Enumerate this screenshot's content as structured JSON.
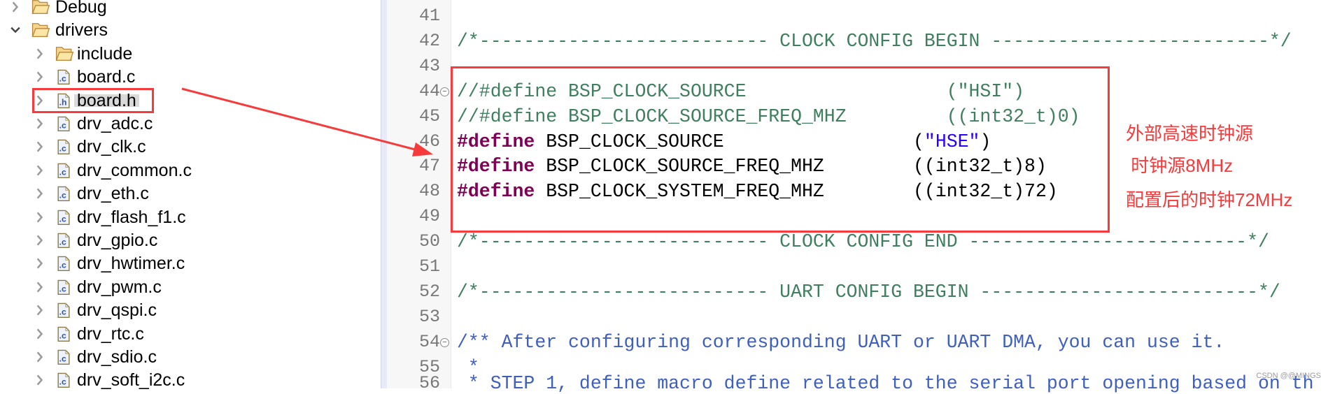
{
  "tree": {
    "items": [
      {
        "label": "Debug",
        "type": "folder",
        "depth": 1,
        "expanded": false
      },
      {
        "label": "drivers",
        "type": "folder",
        "depth": 1,
        "expanded": true
      },
      {
        "label": "include",
        "type": "folder",
        "depth": 2,
        "expanded": false
      },
      {
        "label": "board.c",
        "type": "c-file",
        "depth": 2
      },
      {
        "label": "board.h",
        "type": "h-file",
        "depth": 2,
        "selected": true
      },
      {
        "label": "drv_adc.c",
        "type": "c-file",
        "depth": 2
      },
      {
        "label": "drv_clk.c",
        "type": "c-file",
        "depth": 2
      },
      {
        "label": "drv_common.c",
        "type": "c-file",
        "depth": 2
      },
      {
        "label": "drv_eth.c",
        "type": "c-file",
        "depth": 2
      },
      {
        "label": "drv_flash_f1.c",
        "type": "c-file",
        "depth": 2
      },
      {
        "label": "drv_gpio.c",
        "type": "c-file",
        "depth": 2
      },
      {
        "label": "drv_hwtimer.c",
        "type": "c-file",
        "depth": 2
      },
      {
        "label": "drv_pwm.c",
        "type": "c-file",
        "depth": 2
      },
      {
        "label": "drv_qspi.c",
        "type": "c-file",
        "depth": 2
      },
      {
        "label": "drv_rtc.c",
        "type": "c-file",
        "depth": 2
      },
      {
        "label": "drv_sdio.c",
        "type": "c-file",
        "depth": 2
      },
      {
        "label": "drv_soft_i2c.c",
        "type": "c-file",
        "depth": 2
      }
    ]
  },
  "editor": {
    "lines": [
      {
        "n": "41",
        "parts": []
      },
      {
        "n": "42",
        "parts": [
          {
            "c": "cm",
            "t": "/*-------------------------- CLOCK CONFIG BEGIN -------------------------*/"
          }
        ]
      },
      {
        "n": "43",
        "parts": []
      },
      {
        "n": "44",
        "fold": true,
        "parts": [
          {
            "c": "cm",
            "t": "//#define BSP_CLOCK_SOURCE                  (\"HSI\")"
          }
        ]
      },
      {
        "n": "45",
        "parts": [
          {
            "c": "cm",
            "t": "//#define BSP_CLOCK_SOURCE_FREQ_MHZ         ((int32_t)0)"
          }
        ]
      },
      {
        "n": "46",
        "parts": [
          {
            "c": "kw",
            "t": "#define"
          },
          {
            "c": "",
            "t": " BSP_CLOCK_SOURCE                 ("
          },
          {
            "c": "st",
            "t": "\"HSE\""
          },
          {
            "c": "",
            "t": ")"
          }
        ]
      },
      {
        "n": "47",
        "parts": [
          {
            "c": "kw",
            "t": "#define"
          },
          {
            "c": "",
            "t": " BSP_CLOCK_SOURCE_FREQ_MHZ        ((int32_t)8)"
          }
        ]
      },
      {
        "n": "48",
        "parts": [
          {
            "c": "kw",
            "t": "#define"
          },
          {
            "c": "",
            "t": " BSP_CLOCK_SYSTEM_FREQ_MHZ        ((int32_t)72)"
          }
        ]
      },
      {
        "n": "49",
        "parts": []
      },
      {
        "n": "50",
        "parts": [
          {
            "c": "cm",
            "t": "/*-------------------------- CLOCK CONFIG END -------------------------*/"
          }
        ]
      },
      {
        "n": "51",
        "parts": []
      },
      {
        "n": "52",
        "parts": [
          {
            "c": "cm",
            "t": "/*-------------------------- UART CONFIG BEGIN -------------------------*/"
          }
        ]
      },
      {
        "n": "53",
        "parts": []
      },
      {
        "n": "54",
        "fold": true,
        "parts": [
          {
            "c": "doc",
            "t": "/** After configuring corresponding UART or UART DMA, you can use it."
          }
        ]
      },
      {
        "n": "55",
        "parts": [
          {
            "c": "doc",
            "t": " *"
          }
        ]
      },
      {
        "n": "56",
        "parts": [
          {
            "c": "doc",
            "t": " * STEP 1, define macro define related to the serial port opening based on th"
          }
        ]
      }
    ]
  },
  "annotations": [
    "外部高速时钟源",
    " 时钟源8MHz",
    "配置后的时钟72MHz"
  ],
  "watermark": "CSDN @@MINGS",
  "colors": {
    "highlight": "#f53b3b",
    "comment": "#3f7f5f",
    "keyword": "#7f0055",
    "string": "#2a00ff",
    "javadoc": "#3f5fbf"
  }
}
